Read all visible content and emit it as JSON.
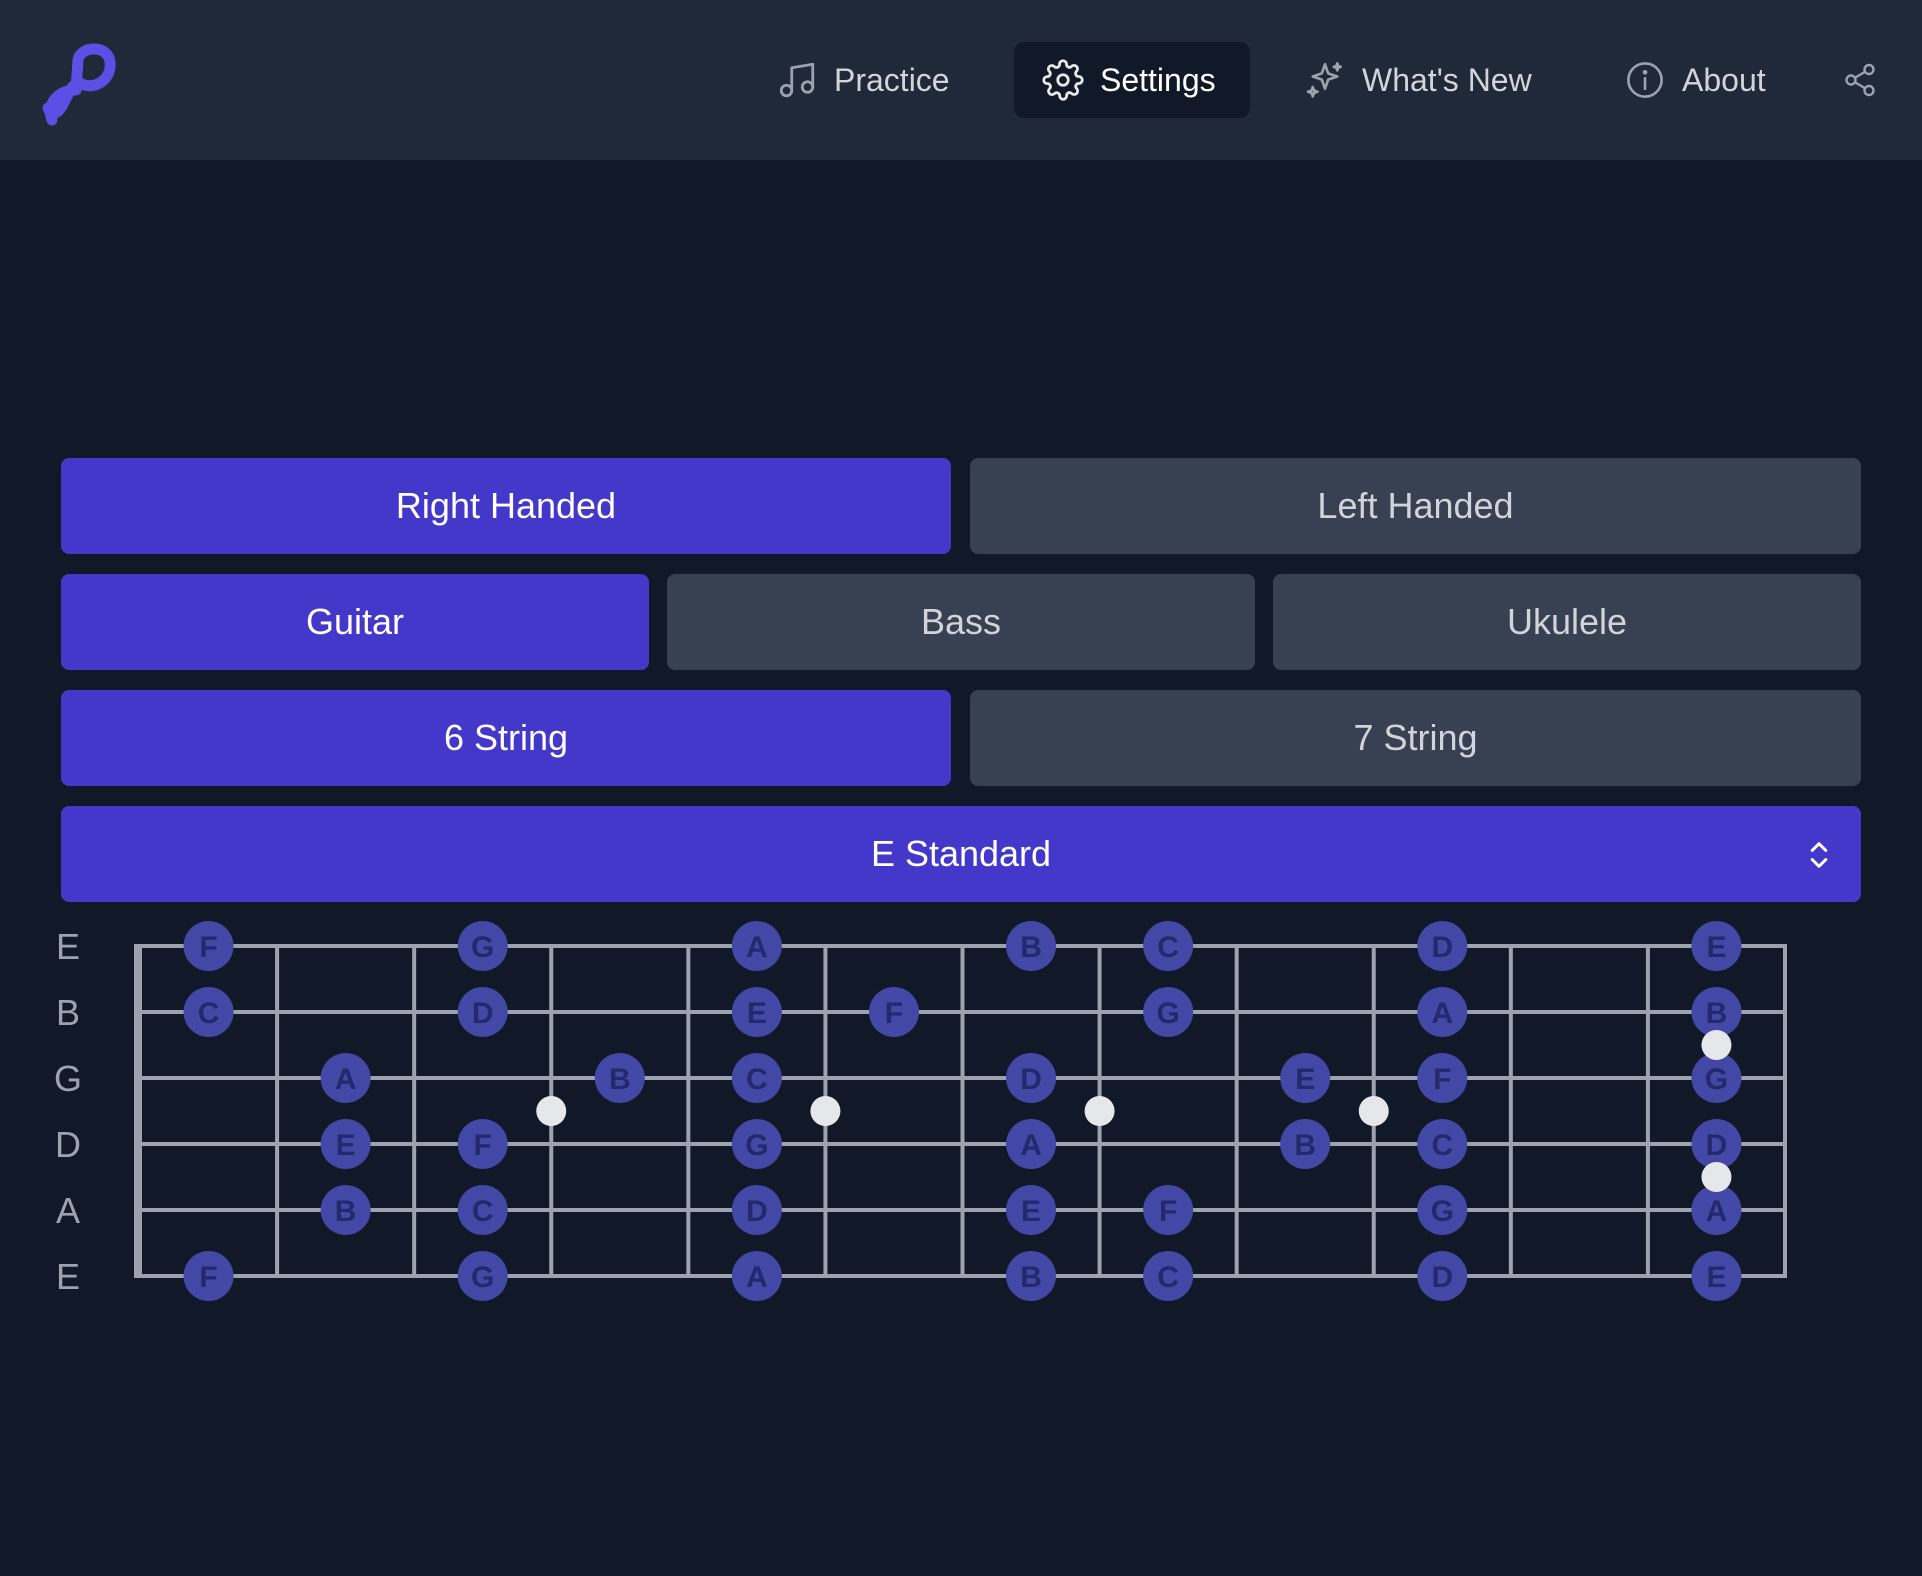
{
  "nav": {
    "logo_icon": "infinity-p-logo",
    "practice": "Practice",
    "settings": "Settings",
    "whats_new": "What's New",
    "about": "About",
    "share_icon": "share-icon"
  },
  "settings": {
    "handedness": {
      "options": [
        "Right Handed",
        "Left Handed"
      ],
      "selected": "Right Handed"
    },
    "instrument": {
      "options": [
        "Guitar",
        "Bass",
        "Ukulele"
      ],
      "selected": "Guitar"
    },
    "strings": {
      "options": [
        "6 String",
        "7 String"
      ],
      "selected": "6 String"
    },
    "tuning": {
      "selected": "E Standard"
    }
  },
  "fretboard": {
    "string_labels": [
      "E",
      "B",
      "G",
      "D",
      "A",
      "E"
    ],
    "frets": 12,
    "notes": [
      [
        "F",
        "G",
        "A",
        "B",
        "C",
        "D",
        "E"
      ],
      [
        "C",
        "D",
        "E",
        "F",
        "G",
        "A",
        "B"
      ],
      [
        "A",
        "B",
        "C",
        "D",
        "E",
        "F",
        "G"
      ],
      [
        "E",
        "F",
        "G",
        "A",
        "B",
        "C",
        "D"
      ],
      [
        "B",
        "C",
        "D",
        "E",
        "F",
        "G",
        "A"
      ],
      [
        "F",
        "G",
        "A",
        "B",
        "C",
        "D",
        "E"
      ]
    ],
    "note_frets": [
      [
        1,
        3,
        5,
        7,
        8,
        10,
        12
      ],
      [
        1,
        3,
        5,
        6,
        8,
        10,
        12
      ],
      [
        2,
        4,
        5,
        7,
        9,
        10,
        12
      ],
      [
        2,
        3,
        5,
        7,
        9,
        10,
        12
      ],
      [
        2,
        3,
        5,
        7,
        8,
        10,
        12
      ],
      [
        1,
        3,
        5,
        7,
        8,
        10,
        12
      ]
    ],
    "inlay_frets": [
      3,
      5,
      7,
      9
    ],
    "double_inlay_fret": 12,
    "colors": {
      "note": "#4348a6",
      "note_text": "#24296b",
      "fret": "#9ca3af",
      "inlay": "#e5e7eb",
      "accent": "#4338ca"
    }
  }
}
